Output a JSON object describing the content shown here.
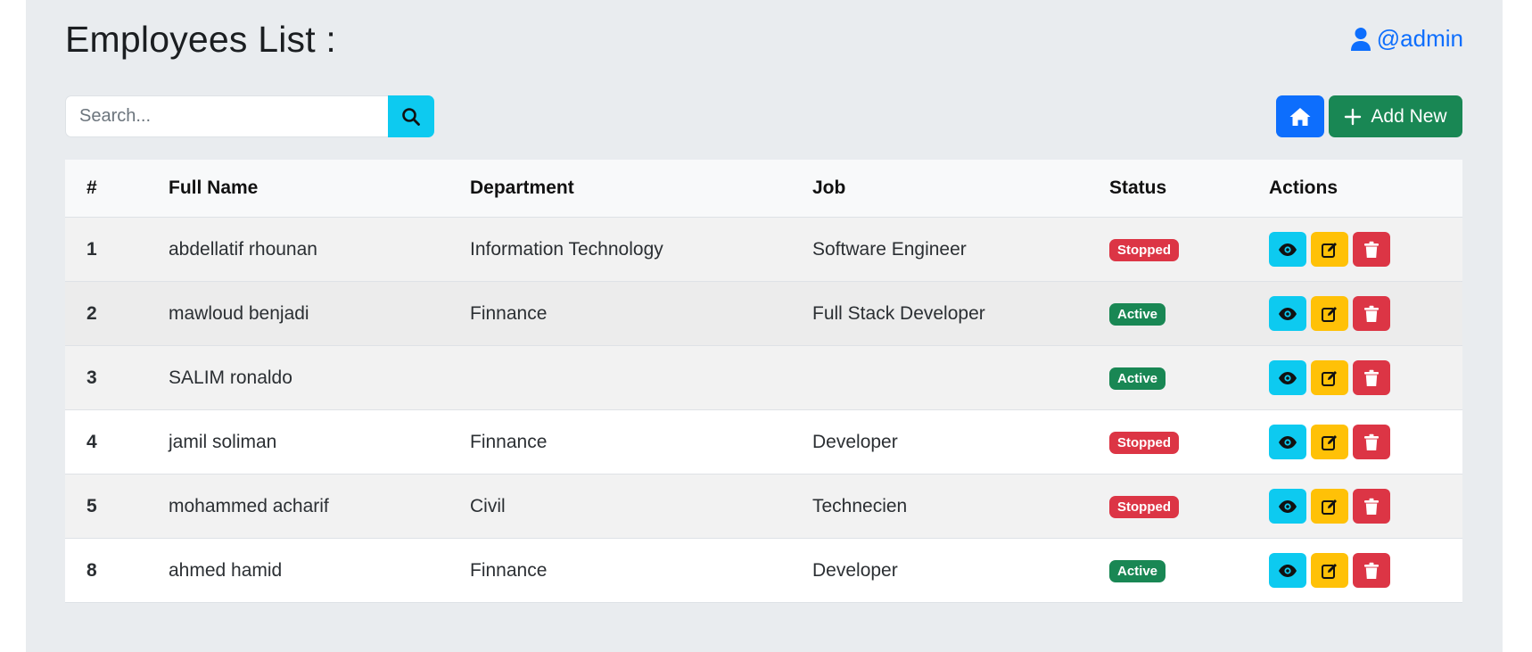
{
  "page": {
    "title": "Employees List :",
    "user": "@admin"
  },
  "search": {
    "placeholder": "Search...",
    "value": ""
  },
  "toolbar": {
    "add_label": "Add New"
  },
  "table": {
    "columns": [
      "#",
      "Full Name",
      "Department",
      "Job",
      "Status",
      "Actions"
    ],
    "rows": [
      {
        "id": "1",
        "name": "abdellatif rhounan",
        "department": "Information Technology",
        "job": "Software Engineer",
        "status": "Stopped"
      },
      {
        "id": "2",
        "name": "mawloud benjadi",
        "department": "Finnance",
        "job": "Full Stack Developer",
        "status": "Active"
      },
      {
        "id": "3",
        "name": "SALIM ronaldo",
        "department": "",
        "job": "",
        "status": "Active"
      },
      {
        "id": "4",
        "name": "jamil soliman",
        "department": "Finnance",
        "job": "Developer",
        "status": "Stopped"
      },
      {
        "id": "5",
        "name": "mohammed acharif",
        "department": "Civil",
        "job": "Technecien",
        "status": "Stopped"
      },
      {
        "id": "8",
        "name": "ahmed hamid",
        "department": "Finnance",
        "job": "Developer",
        "status": "Active"
      }
    ]
  },
  "icons": {
    "user": "user-icon",
    "search": "search-icon",
    "home": "home-icon",
    "add": "plus-icon",
    "view": "eye-icon",
    "edit": "edit-icon",
    "delete": "trash-icon"
  },
  "colors": {
    "primary": "#0d6efd",
    "info": "#0dcaf0",
    "success": "#198754",
    "warning": "#ffc107",
    "danger": "#dc3545"
  }
}
